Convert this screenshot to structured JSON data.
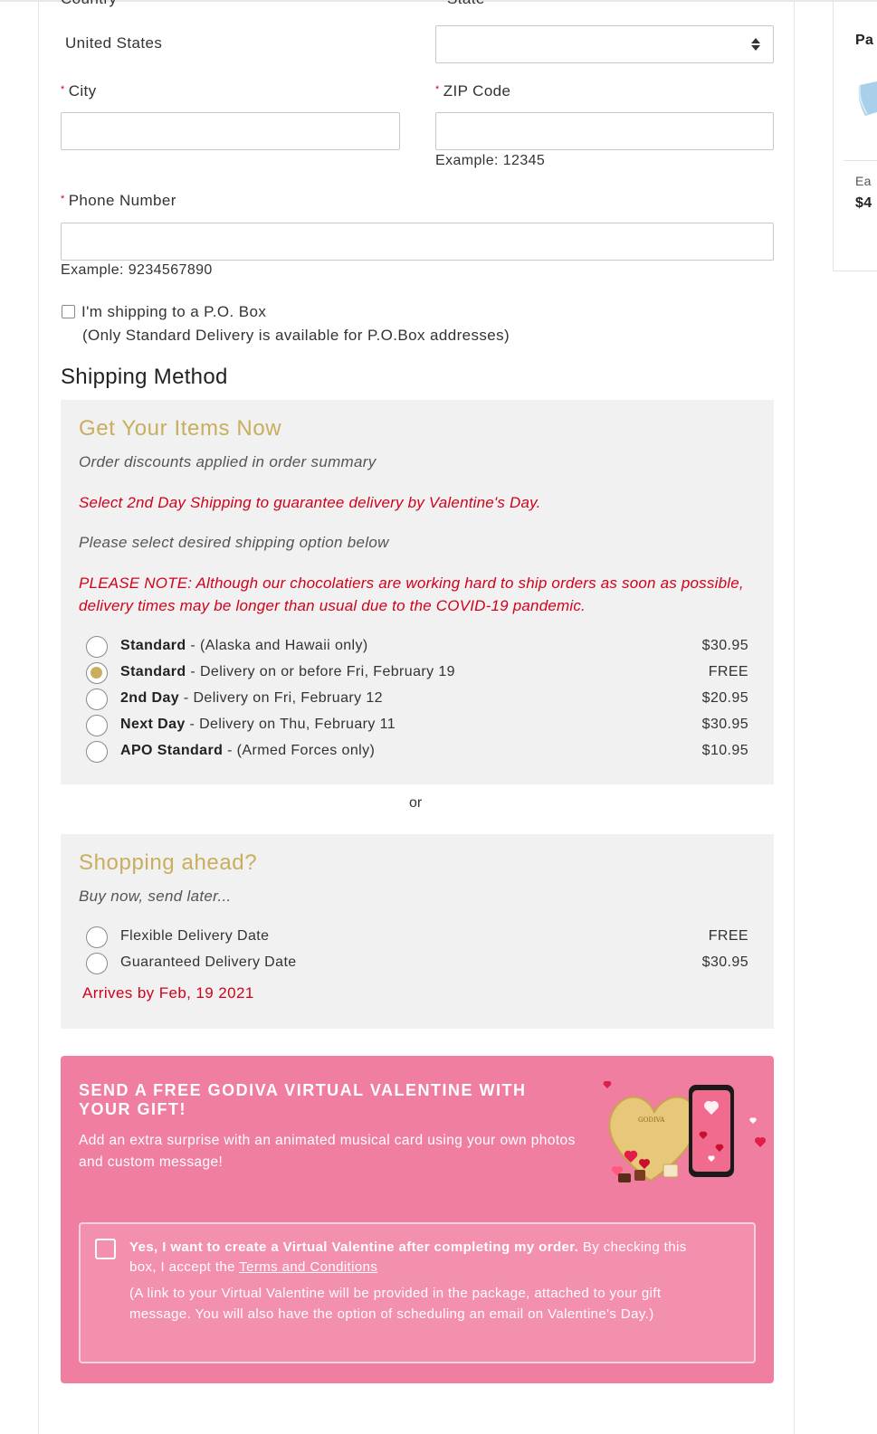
{
  "form": {
    "country_label_cut": "Country",
    "state_label_cut": "State",
    "country_value": "United States",
    "state_value": "",
    "city_label": "City",
    "zip_label": "ZIP Code",
    "zip_hint": "Example: 12345",
    "phone_label": "Phone Number",
    "phone_hint": "Example: 9234567890",
    "po_box_label": "I'm shipping to a P.O. Box",
    "po_box_note": "(Only Standard Delivery is available for P.O.Box addresses)",
    "required_marker": "*"
  },
  "shipping": {
    "section_title": "Shipping Method",
    "now_title": "Get Your Items Now",
    "now_note": "Order discounts applied in order summary",
    "now_red_1": "Select 2nd Day Shipping to guarantee delivery by Valentine's Day.",
    "now_note_2": "Please select desired shipping option below",
    "now_red_2": "PLEASE NOTE: Although our chocolatiers are working hard to ship orders as soon as possible, delivery times may be longer than usual due to the COVID-19 pandemic.",
    "options": [
      {
        "name": "Standard",
        "desc": " - (Alaska and Hawaii only)",
        "price": "$30.95",
        "selected": false
      },
      {
        "name": "Standard",
        "desc": " - Delivery on or before Fri, February 19",
        "price": "FREE",
        "selected": true
      },
      {
        "name": "2nd Day",
        "desc": " - Delivery on Fri, February 12",
        "price": "$20.95",
        "selected": false
      },
      {
        "name": "Next Day",
        "desc": " - Delivery on Thu, February 11",
        "price": "$30.95",
        "selected": false
      },
      {
        "name": "APO Standard",
        "desc": " - (Armed Forces only)",
        "price": "$10.95",
        "selected": false
      }
    ],
    "or_label": "or",
    "ahead_title": "Shopping ahead?",
    "ahead_note": "Buy now, send later...",
    "ahead_options": [
      {
        "label": "Flexible Delivery Date",
        "price": "FREE"
      },
      {
        "label": "Guaranteed Delivery Date",
        "price": "$30.95"
      }
    ],
    "ahead_arrival": "Arrives by Feb, 19 2021"
  },
  "promo": {
    "title": "SEND A FREE GODIVA VIRTUAL VALENTINE WITH YOUR GIFT!",
    "desc": "Add an extra surprise with an animated musical card using your own photos and custom message!",
    "check_bold": "Yes, I want to create a Virtual Valentine after completing my order.",
    "check_rest": " By checking this box, I accept the ",
    "terms_link": "Terms and Conditions",
    "sub_note": "(A link to your Virtual Valentine will be provided in the package, attached to your gift message. You will also have the option of scheduling an email on Valentine's Day.)",
    "art_brand": "GODIVA",
    "colors": {
      "background": "#f07ea0",
      "box": "#f390ae",
      "accent_gold": "#c9ae5d",
      "alert_red": "#d0021b"
    }
  },
  "sidebar": {
    "cut_label_1": "Pa",
    "cut_label_2": "Ea",
    "cut_label_3": "$4"
  }
}
